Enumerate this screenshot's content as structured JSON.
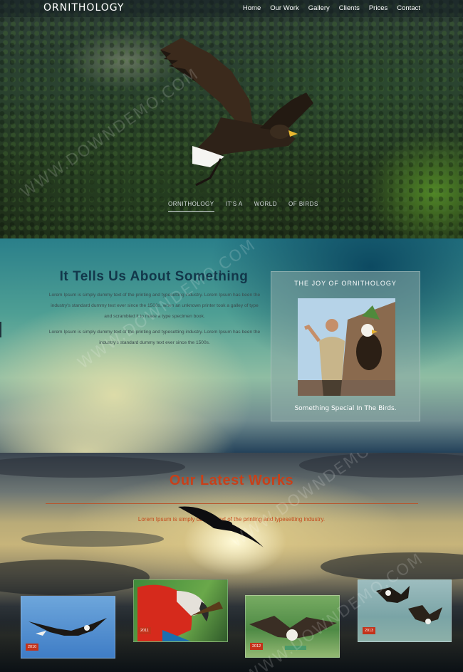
{
  "brand": {
    "logo": "ORNITHOLOGY"
  },
  "nav": {
    "items": [
      "Home",
      "Our Work",
      "Gallery",
      "Clients",
      "Prices",
      "Contact"
    ]
  },
  "hero": {
    "words": [
      "ORNITHOLOGY",
      "IT'S A",
      "WORLD",
      "OF BIRDS"
    ]
  },
  "watermark": "WWW.DOWNDEMO.COM",
  "about": {
    "title": "It Tells Us About Something",
    "paragraph1": "Lorem Ipsum is simply dummy text of the printing and typesetting industry. Lorem Ipsum has been the industry's standard dummy text ever since the 1500s, when an unknown printer took a galley of type and scrambled it to make a type specimen book.",
    "paragraph2": "Lorem Ipsum is simply dummy text of the printing and typesetting industry. Lorem Ipsum has been the industry's standard dummy text ever since the 1500s.",
    "card": {
      "title": "THE JOY OF ORNITHOLOGY",
      "caption": "Something Special In The Birds."
    }
  },
  "works": {
    "title": "Our Latest Works",
    "subtitle": "Lorem Ipsum is simply dummy text of the printing and typesetting industry.",
    "items": [
      {
        "year": "2010"
      },
      {
        "year": "2011"
      },
      {
        "year": "2012"
      },
      {
        "year": "2013"
      }
    ]
  },
  "colors": {
    "accent": "#c74019",
    "badge": "#c4321a",
    "heading": "#12374a"
  }
}
